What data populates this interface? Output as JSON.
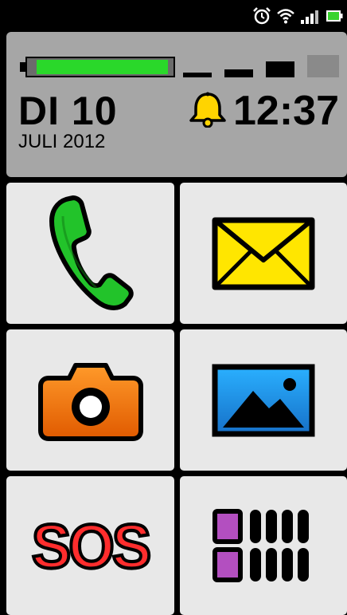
{
  "status_bar": {
    "icons": [
      "alarm-clock-icon",
      "wifi-icon",
      "cell-signal-icon",
      "battery-icon"
    ]
  },
  "header": {
    "battery_level_fraction": 0.97,
    "signal_bars": 4,
    "signal_active_bars": 3,
    "day": "DI 10",
    "month_year": "JULI 2012",
    "alarm_icon": "bell-icon",
    "time": "12:37"
  },
  "tiles": [
    {
      "id": "phone",
      "icon": "phone-icon",
      "color": "#22c32a"
    },
    {
      "id": "messages",
      "icon": "envelope-icon",
      "color": "#ffe600"
    },
    {
      "id": "camera",
      "icon": "camera-icon",
      "color": "#f07a12"
    },
    {
      "id": "gallery",
      "icon": "picture-icon",
      "color": "#1e9be6"
    },
    {
      "id": "sos",
      "label": "SOS",
      "color": "#ff2d2d"
    },
    {
      "id": "apps",
      "icon": "apps-grid-icon",
      "color": "#b34fc0"
    }
  ]
}
